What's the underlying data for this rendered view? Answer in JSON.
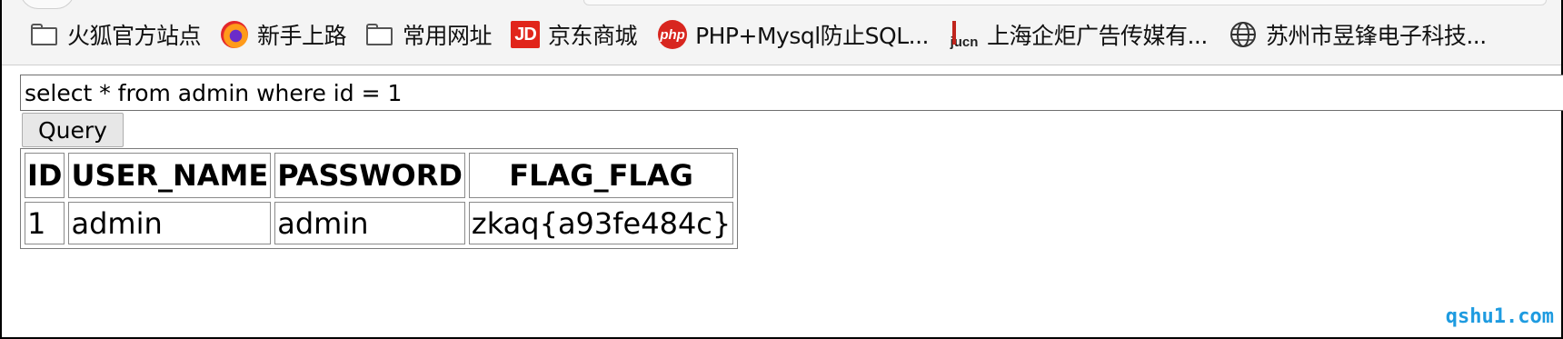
{
  "bookmarks": [
    {
      "label": "火狐官方站点",
      "icon": "folder-icon"
    },
    {
      "label": "新手上路",
      "icon": "firefox-icon"
    },
    {
      "label": "常用网址",
      "icon": "folder-icon"
    },
    {
      "label": "京东商城",
      "icon": "jd-icon",
      "icon_text": "JD"
    },
    {
      "label": "PHP+Mysql防止SQL...",
      "icon": "php-icon",
      "icon_text": "php"
    },
    {
      "label": "上海企炬广告传媒有...",
      "icon": "jucn-icon",
      "icon_text": "jucn"
    },
    {
      "label": "苏州市昱锋电子科技...",
      "icon": "globe-icon"
    }
  ],
  "query": {
    "value": "select * from admin where id = 1",
    "button_label": "Query"
  },
  "results": {
    "headers": [
      "ID",
      "USER_NAME",
      "PASSWORD",
      "FLAG_FLAG"
    ],
    "rows": [
      [
        "1",
        "admin",
        "admin",
        "zkaq{a93fe484c}"
      ]
    ]
  },
  "watermark": "qshu1.com",
  "colors": {
    "jd_red": "#e1251b",
    "php_red": "#d8261f",
    "watermark_blue": "#1e9be0"
  }
}
